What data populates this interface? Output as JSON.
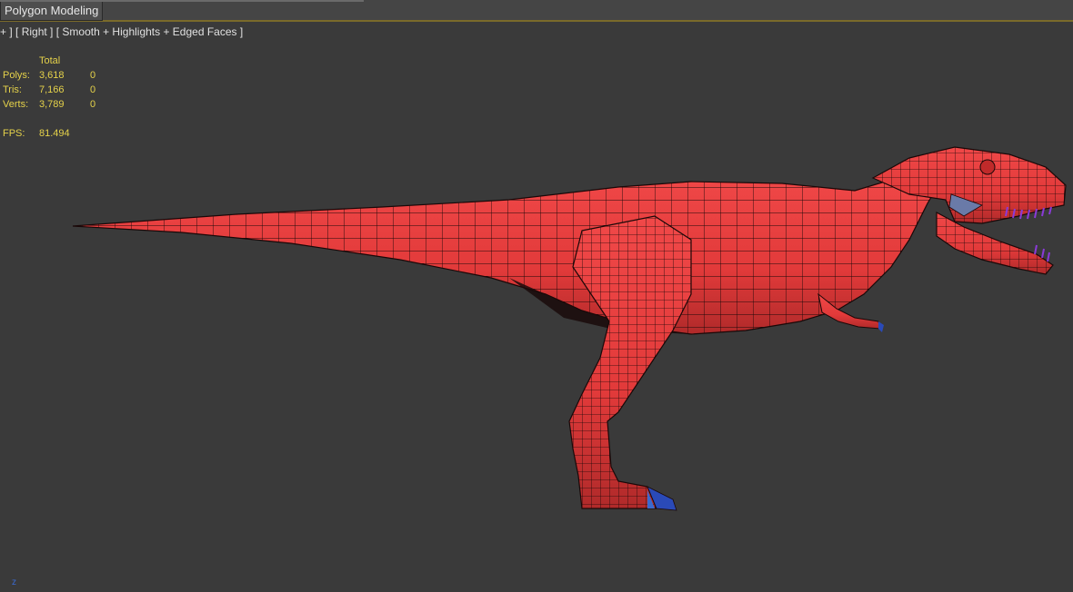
{
  "ribbon": {
    "active_tab": "Polygon Modeling"
  },
  "viewport": {
    "label_plus": "+ ]",
    "label_view": "[ Right ]",
    "label_shading": "[ Smooth + Highlights + Edged Faces ]",
    "stats": {
      "header": "Total",
      "rows": [
        {
          "label": "Polys:",
          "total": "3,618",
          "selected": "0"
        },
        {
          "label": "Tris:",
          "total": "7,166",
          "selected": "0"
        },
        {
          "label": "Verts:",
          "total": "3,789",
          "selected": "0"
        }
      ],
      "fps_label": "FPS:",
      "fps_value": "81.494"
    },
    "axis_label": "z"
  },
  "colors": {
    "background": "#3a3a3a",
    "mesh_fill": "#e23a3a",
    "mesh_dark": "#a82424",
    "edge": "#1a0808",
    "stats_text": "#e5d24a",
    "teeth": "#8a3ad8",
    "claws": "#2a4ab8"
  }
}
